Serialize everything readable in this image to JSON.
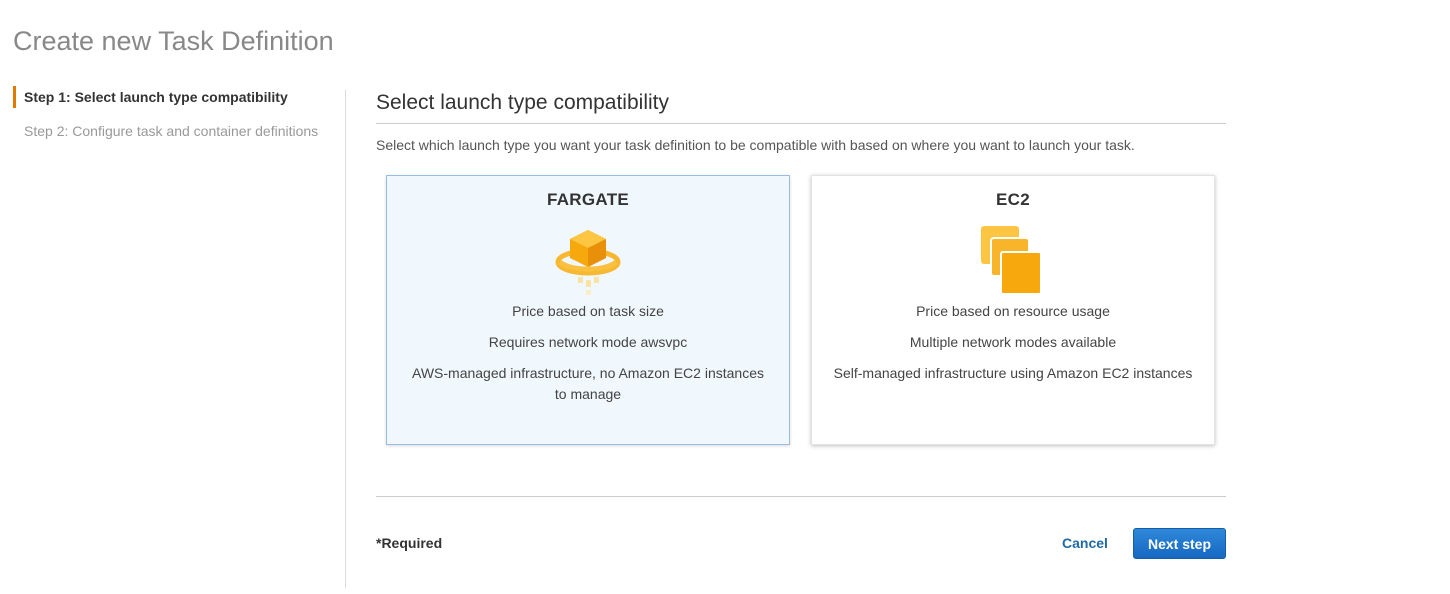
{
  "page": {
    "title": "Create new Task Definition"
  },
  "steps": [
    {
      "label": "Step 1: Select launch type compatibility",
      "active": true
    },
    {
      "label": "Step 2: Configure task and container definitions",
      "active": false
    }
  ],
  "main": {
    "section_title": "Select launch type compatibility",
    "description": "Select which launch type you want your task definition to be compatible with based on where you want to launch your task."
  },
  "cards": [
    {
      "title": "FARGATE",
      "icon": "fargate-icon",
      "selected": true,
      "lines": [
        "Price based on task size",
        "Requires network mode awsvpc",
        "AWS-managed infrastructure, no Amazon EC2 instances to manage"
      ]
    },
    {
      "title": "EC2",
      "icon": "ec2-instances-icon",
      "selected": false,
      "lines": [
        "Price based on resource usage",
        "Multiple network modes available",
        "Self-managed infrastructure using Amazon EC2 instances"
      ]
    }
  ],
  "footer": {
    "required": "*Required",
    "cancel": "Cancel",
    "next": "Next step"
  },
  "colors": {
    "accent": "#e07b00",
    "primary_button": "#1f74c8",
    "link": "#1f6aa5",
    "selected_card_bg": "#f0f7fd",
    "icon_orange": "#f7a80d"
  }
}
